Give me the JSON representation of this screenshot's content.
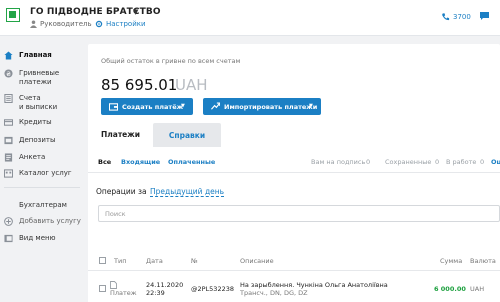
{
  "header": {
    "org_name": "ГО ПІДВОДНЕ БРАТСТВО",
    "role": "Руководитель",
    "settings_label": "Настройки",
    "phone": "3700",
    "accent": "#1b7fc4",
    "brand": "#22a447"
  },
  "sidebar": {
    "items": [
      {
        "label": "Главная",
        "icon": "home-icon"
      },
      {
        "label": "Гривневые",
        "label2": "платежи",
        "icon": "hryvnia-icon"
      },
      {
        "label": "Счета",
        "label2": "и выписки",
        "icon": "document-list-icon"
      },
      {
        "label": "Кредиты",
        "icon": "credit-icon"
      },
      {
        "label": "Депозиты",
        "icon": "deposit-icon"
      },
      {
        "label": "Анкета",
        "icon": "form-icon"
      },
      {
        "label": "Каталог услуг",
        "icon": "catalog-icon"
      }
    ],
    "bottom": [
      {
        "label": "Бухгалтерам"
      },
      {
        "label": "Добавить услугу",
        "icon": "plus-circle-icon"
      },
      {
        "label": "Вид меню",
        "icon": "menu-view-icon"
      }
    ]
  },
  "balance": {
    "caption": "Общий остаток в гривне по всем счетам",
    "amount": "85 695.01",
    "currency": "UAH",
    "create_payment": "Создать платёж",
    "import_payments": "Импортировать платежи"
  },
  "tabs": [
    {
      "label": "Платежи",
      "active": true
    },
    {
      "label": "Справки",
      "active": false
    }
  ],
  "filters": {
    "all": "Все",
    "incoming": "Входящие",
    "paid": "Оплаченные",
    "for_sign": "Вам на подпись",
    "for_sign_count": "0",
    "saved": "Сохраненные",
    "saved_count": "0",
    "in_work": "В работе",
    "in_work_count": "0",
    "truncated": "Ош"
  },
  "operations": {
    "label": "Операции за",
    "period": "Предыдущий день",
    "search_placeholder": "Поиск"
  },
  "table": {
    "columns": {
      "type": "Тип",
      "date": "Дата",
      "number": "№",
      "description": "Описание",
      "amount": "Сумма",
      "currency": "Валюта"
    },
    "rows": [
      {
        "type": "Платеж",
        "date": "24.11.2020",
        "time": "22:39",
        "number": "@2PL532238",
        "description": "На зарыблення. Чункіна Ольга Анатоліївна",
        "tags": "Трансч., DN, DG, DZ",
        "amount": "6 000.00",
        "currency": "UAH"
      }
    ]
  }
}
